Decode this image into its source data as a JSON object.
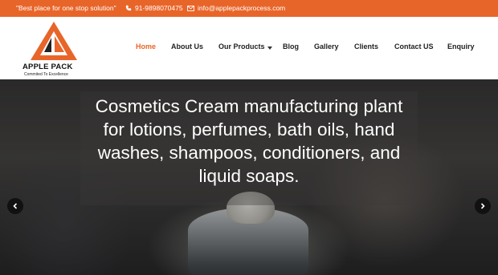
{
  "topbar": {
    "tagline": "\"Best place for one stop solution\"",
    "phone": "91-9898070475",
    "email": "info@applepackprocess.com",
    "phone_icon": "phone-icon",
    "email_icon": "envelope-icon"
  },
  "brand": {
    "name": "APPLE PACK",
    "tagline": "Commited To Excellence",
    "accent_color": "#e8652a"
  },
  "nav": {
    "items": [
      {
        "label": "Home",
        "active": true
      },
      {
        "label": "About Us"
      },
      {
        "label": "Our Products",
        "has_dropdown": true
      },
      {
        "label": "Blog"
      },
      {
        "label": "Gallery"
      },
      {
        "label": "Clients"
      },
      {
        "label": "Contact US"
      },
      {
        "label": "Enquiry"
      }
    ]
  },
  "hero": {
    "headline_lines": [
      "Cosmetics Cream manufacturing plant",
      "for lotions, perfumes, bath oils, hand",
      "washes, shampoos, conditioners, and",
      "liquid soaps."
    ],
    "prev_icon": "chevron-left-icon",
    "next_icon": "chevron-right-icon"
  }
}
